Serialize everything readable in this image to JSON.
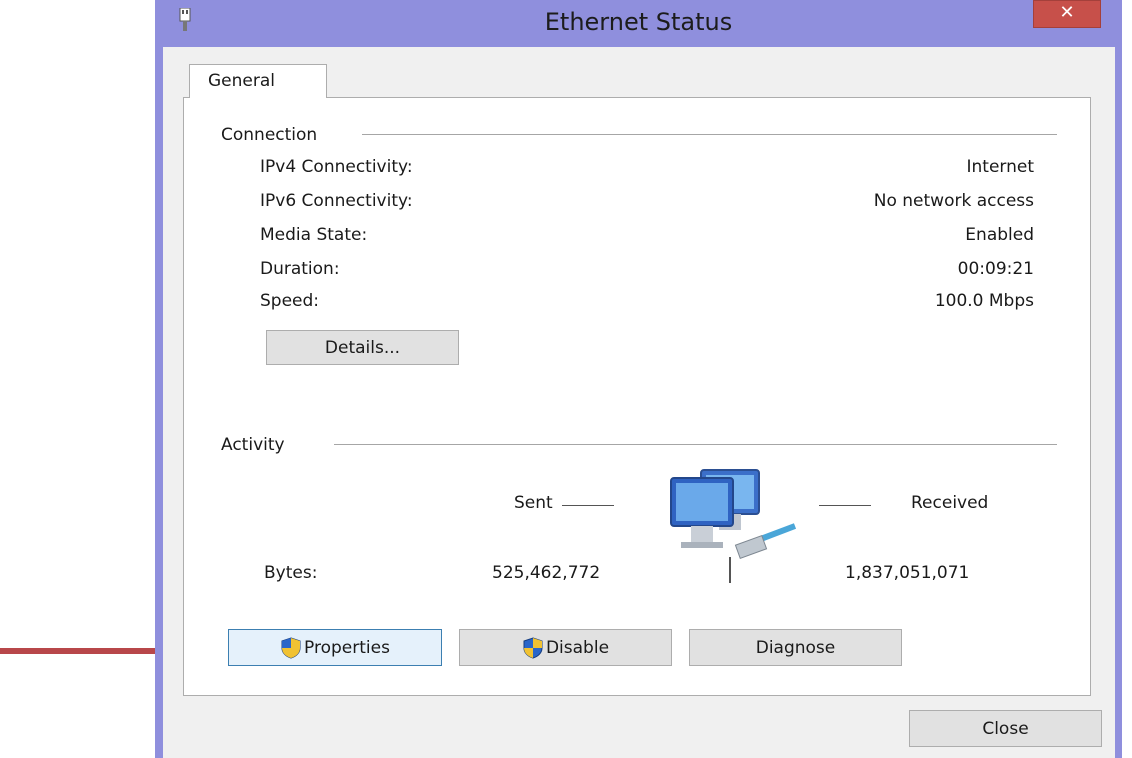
{
  "window": {
    "title": "Ethernet Status",
    "close_glyph": "✕",
    "tab": "General"
  },
  "connection": {
    "label": "Connection",
    "rows": [
      {
        "key": "IPv4 Connectivity:",
        "value": "Internet"
      },
      {
        "key": "IPv6 Connectivity:",
        "value": "No network access"
      },
      {
        "key": "Media State:",
        "value": "Enabled"
      },
      {
        "key": "Duration:",
        "value": "00:09:21"
      },
      {
        "key": "Speed:",
        "value": "100.0 Mbps"
      }
    ],
    "details_button": "Details..."
  },
  "activity": {
    "label": "Activity",
    "sent_label": "Sent",
    "received_label": "Received",
    "bytes_label": "Bytes:",
    "bytes_sent": "525,462,772",
    "bytes_received": "1,837,051,071"
  },
  "buttons": {
    "properties": "Properties",
    "disable": "Disable",
    "diagnose": "Diagnose",
    "close": "Close"
  },
  "icons": {
    "app": "network-plug-icon",
    "activity": "network-computers-icon",
    "shield": "uac-shield-icon",
    "pointer": "red-arrow-icon"
  },
  "colors": {
    "window_frame": "#8f8fdd",
    "close_button": "#c7504a",
    "highlight_border": "#3c7fb1",
    "arrow": "#b8474a"
  }
}
